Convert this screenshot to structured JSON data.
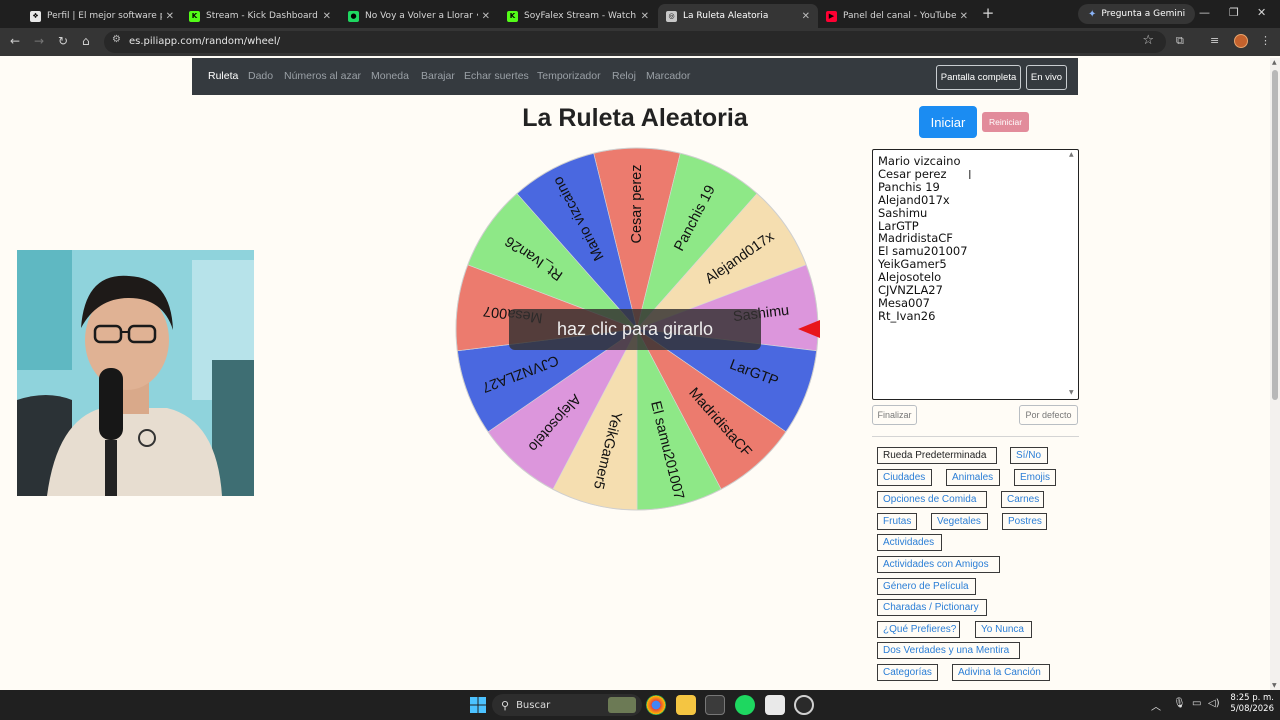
{
  "browser": {
    "tabs": [
      {
        "title": "Perfil | El mejor software para p",
        "favicon_color": "#e8e8e8",
        "glyph": "❖",
        "active": false
      },
      {
        "title": "Stream - Kick Dashboard",
        "favicon_color": "#53fc18",
        "glyph": "K",
        "active": false
      },
      {
        "title": "No Voy a Volver a Llorar • R",
        "favicon_color": "#1ed760",
        "glyph": "●",
        "active": false
      },
      {
        "title": "SoyFalex Stream - Watch Live o",
        "favicon_color": "#53fc18",
        "glyph": "K",
        "active": false
      },
      {
        "title": "La Ruleta Aleatoria",
        "favicon_color": "#c8c8c8",
        "glyph": "◎",
        "active": true
      },
      {
        "title": "Panel del canal - YouTube Studi",
        "favicon_color": "#ff0033",
        "glyph": "▶",
        "active": false
      }
    ],
    "new_tab": "+",
    "gemini_label": "Pregunta a Gemini",
    "url": "es.piliapp.com/random/wheel/"
  },
  "navbar": {
    "links": [
      "Ruleta",
      "Dado",
      "Números al azar",
      "Moneda",
      "Barajar",
      "Echar suertes",
      "Temporizador",
      "Reloj",
      "Marcador"
    ],
    "fullscreen_label": "Pantalla completa",
    "live_label": "En vivo"
  },
  "main": {
    "title": "La Ruleta Aleatoria",
    "spin_overlay": "haz clic para girarlo",
    "start_label": "Iniciar",
    "reset_label": "Reiniciar",
    "names": [
      "Mario vizcaino",
      "Cesar perez",
      "Panchis 19",
      "Alejand017x",
      "Sashimu",
      "LarGTP",
      "MadridistaCF",
      "El samu201007",
      "YeikGamer5",
      "Alejosotelo",
      "CJVNZLA27",
      "Mesa007",
      "Rt_Ivan26"
    ],
    "finish_label": "Finalizar",
    "default_label": "Por defecto",
    "presets": [
      "Rueda Predeterminada",
      "Sí/No",
      "Ciudades",
      "Animales",
      "Emojis",
      "Opciones de Comida",
      "Carnes",
      "Frutas",
      "Vegetales",
      "Postres",
      "Actividades",
      "Actividades con Amigos",
      "Género de Película",
      "Charadas / Pictionary",
      "¿Qué Prefieres?",
      "Yo Nunca",
      "Dos Verdades y una Mentira",
      "Categorías",
      "Adivina la Canción"
    ]
  },
  "wheel": {
    "segments": [
      {
        "label": "Cesar perez",
        "color": "#ec7b6e"
      },
      {
        "label": "Panchis 19",
        "color": "#8ee887"
      },
      {
        "label": "Alejand017x",
        "color": "#f5deb0"
      },
      {
        "label": "Sashimu",
        "color": "#dc96dc"
      },
      {
        "label": "LarGTP",
        "color": "#4a68e0"
      },
      {
        "label": "MadridistaCF",
        "color": "#ec7b6e"
      },
      {
        "label": "El samu201007",
        "color": "#8ee887"
      },
      {
        "label": "YeikGamer5",
        "color": "#f5deb0"
      },
      {
        "label": "Alejosotelo",
        "color": "#dc96dc"
      },
      {
        "label": "CJVNZLA27",
        "color": "#4a68e0"
      },
      {
        "label": "Mesa007",
        "color": "#ec7b6e"
      },
      {
        "label": "Rt_Ivan26",
        "color": "#8ee887"
      },
      {
        "label": "Mario vizcaino",
        "color": "#4a68e0"
      }
    ],
    "pointer_color": "#e8161b"
  },
  "taskbar": {
    "search_label": "Buscar",
    "time": "8:25 p. m.",
    "date": "5/08/2026"
  }
}
